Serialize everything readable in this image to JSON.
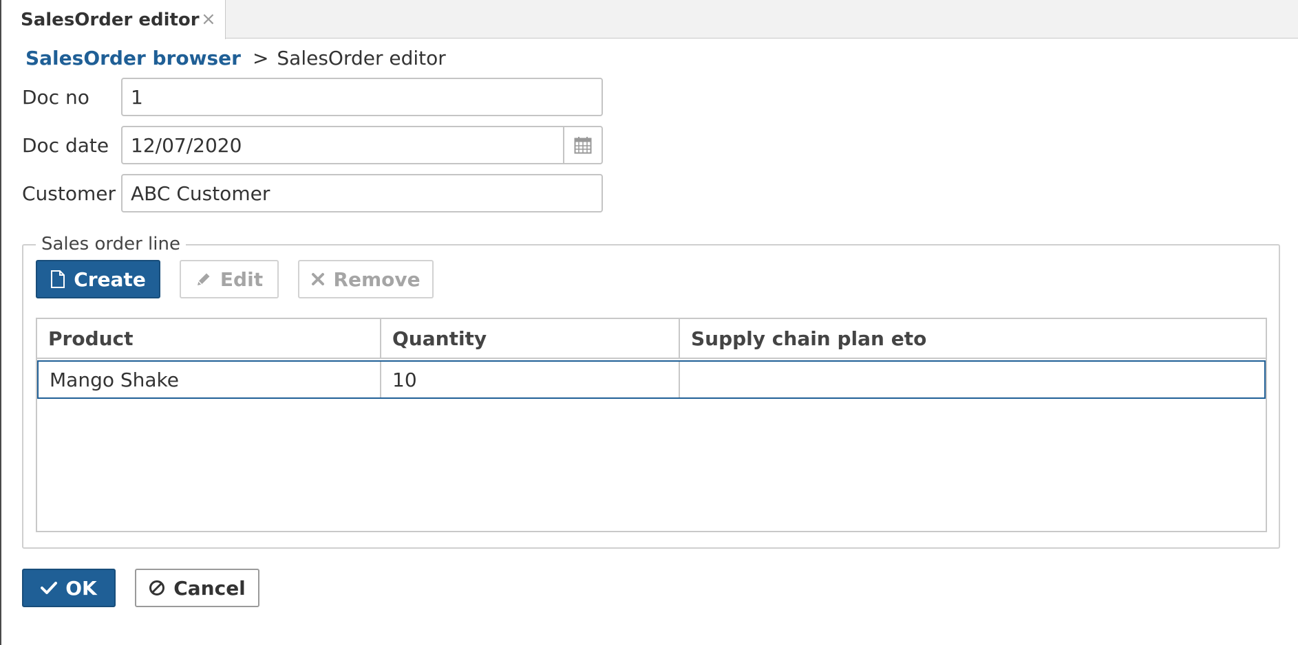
{
  "tab": {
    "title": "SalesOrder editor",
    "close_glyph": "×"
  },
  "breadcrumb": {
    "parent": "SalesOrder browser",
    "separator": ">",
    "current": "SalesOrder editor"
  },
  "form": {
    "doc_no": {
      "label": "Doc no",
      "value": "1"
    },
    "doc_date": {
      "label": "Doc date",
      "value": "12/07/2020",
      "icon": "calendar-icon"
    },
    "customer": {
      "label": "Customer",
      "value": "ABC Customer"
    }
  },
  "lines": {
    "legend": "Sales order line",
    "buttons": {
      "create": {
        "label": "Create",
        "icon": "file-icon",
        "enabled": true
      },
      "edit": {
        "label": "Edit",
        "icon": "pencil-icon",
        "enabled": false
      },
      "remove": {
        "label": "Remove",
        "icon": "times-icon",
        "enabled": false
      }
    },
    "columns": [
      "Product",
      "Quantity",
      "Supply chain plan eto"
    ],
    "rows": [
      {
        "product": "Mango Shake",
        "quantity": "10",
        "supply_chain_plan_eto": ""
      }
    ]
  },
  "actions": {
    "ok": {
      "label": "OK",
      "icon": "check-icon"
    },
    "cancel": {
      "label": "Cancel",
      "icon": "ban-icon"
    }
  },
  "colors": {
    "primary": "#1f5f96",
    "link": "#1f5f96",
    "border": "#c4c4c4",
    "disabled_text": "#a5a5a5"
  }
}
